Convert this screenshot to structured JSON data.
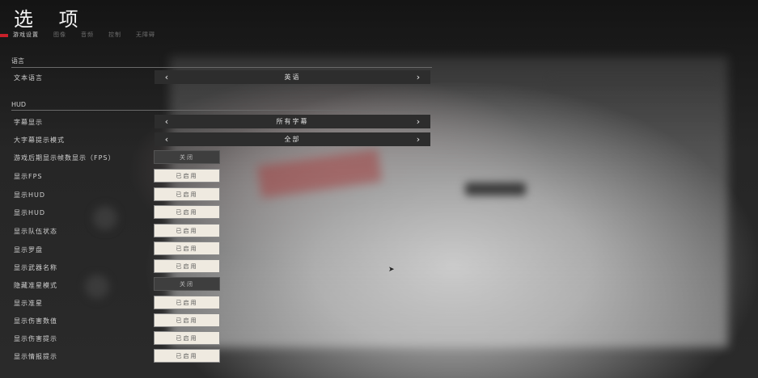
{
  "header": {
    "title": "选 项"
  },
  "tabs": [
    {
      "label": "游戏设置",
      "active": true
    },
    {
      "label": "图像",
      "active": false
    },
    {
      "label": "音频",
      "active": false
    },
    {
      "label": "控制",
      "active": false
    },
    {
      "label": "无障碍",
      "active": false
    }
  ],
  "sections": {
    "language": "语言",
    "hud": "HUD"
  },
  "language_row": {
    "label": "文本语言",
    "value": "英语"
  },
  "selector_rows": [
    {
      "label": "字幕显示",
      "value": "所有字幕"
    },
    {
      "label": "大字幕提示模式",
      "value": "全部"
    }
  ],
  "toggle_rows": [
    {
      "label": "游戏后期显示帧数显示（FPS）",
      "value": "关闭",
      "on": false
    },
    {
      "label": "显示FPS",
      "value": "已启用",
      "on": true
    },
    {
      "label": "显示HUD",
      "value": "已启用",
      "on": true
    },
    {
      "label": "显示HUD",
      "value": "已启用",
      "on": true
    },
    {
      "label": "显示队伍状态",
      "value": "已启用",
      "on": true
    },
    {
      "label": "显示罗盘",
      "value": "已启用",
      "on": true
    },
    {
      "label": "显示武器名称",
      "value": "已启用",
      "on": true
    },
    {
      "label": "隐藏准星模式",
      "value": "关闭",
      "on": false
    },
    {
      "label": "显示准星",
      "value": "已启用",
      "on": true
    },
    {
      "label": "显示伤害数值",
      "value": "已启用",
      "on": true
    },
    {
      "label": "显示伤害提示",
      "value": "已启用",
      "on": true
    },
    {
      "label": "显示情报提示",
      "value": "已启用",
      "on": true
    }
  ],
  "colors": {
    "accent": "#c8202a",
    "toggle_on": "#efeae0",
    "toggle_off": "#3e3e3e",
    "selector": "#2d2d2d"
  }
}
